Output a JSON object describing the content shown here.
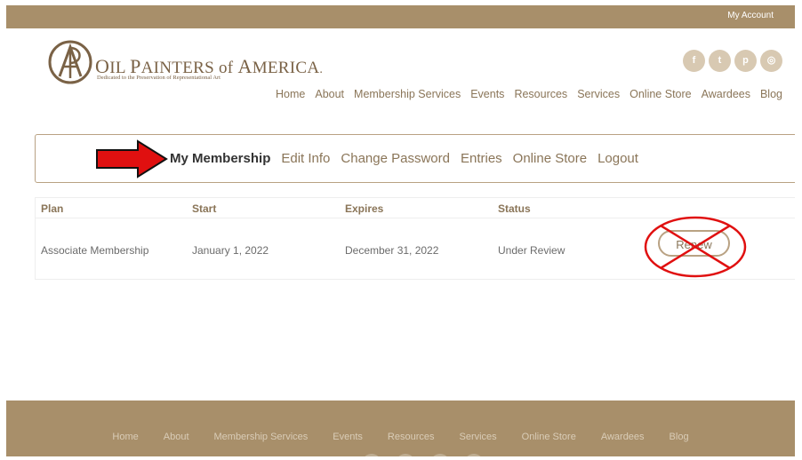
{
  "topbar": {
    "my_account": "My Account"
  },
  "brand": {
    "name": "Oil Painters of America",
    "tagline": "Dedicated to the Preservation of Representational Art"
  },
  "social": [
    {
      "icon": "facebook-icon",
      "glyph": "f"
    },
    {
      "icon": "twitter-icon",
      "glyph": "t"
    },
    {
      "icon": "pinterest-icon",
      "glyph": "p"
    },
    {
      "icon": "instagram-icon",
      "glyph": "◎"
    }
  ],
  "main_nav": [
    "Home",
    "About",
    "Membership Services",
    "Events",
    "Resources",
    "Services",
    "Online Store",
    "Awardees",
    "Blog"
  ],
  "account_nav": {
    "active": "My Membership",
    "items": [
      "Edit Info",
      "Change Password",
      "Entries",
      "Online Store",
      "Logout"
    ]
  },
  "table": {
    "headers": [
      "Plan",
      "Start",
      "Expires",
      "Status"
    ],
    "rows": [
      {
        "plan": "Associate Membership",
        "start": "January 1, 2022",
        "expires": "December 31, 2022",
        "status": "Under Review",
        "action": "Renew"
      }
    ]
  },
  "footer_nav": [
    "Home",
    "About",
    "Membership Services",
    "Events",
    "Resources",
    "Services",
    "Online Store",
    "Awardees",
    "Blog"
  ],
  "colors": {
    "brand": "#a88f6a",
    "accent_text": "#8a7558",
    "annotation": "#e01010"
  }
}
